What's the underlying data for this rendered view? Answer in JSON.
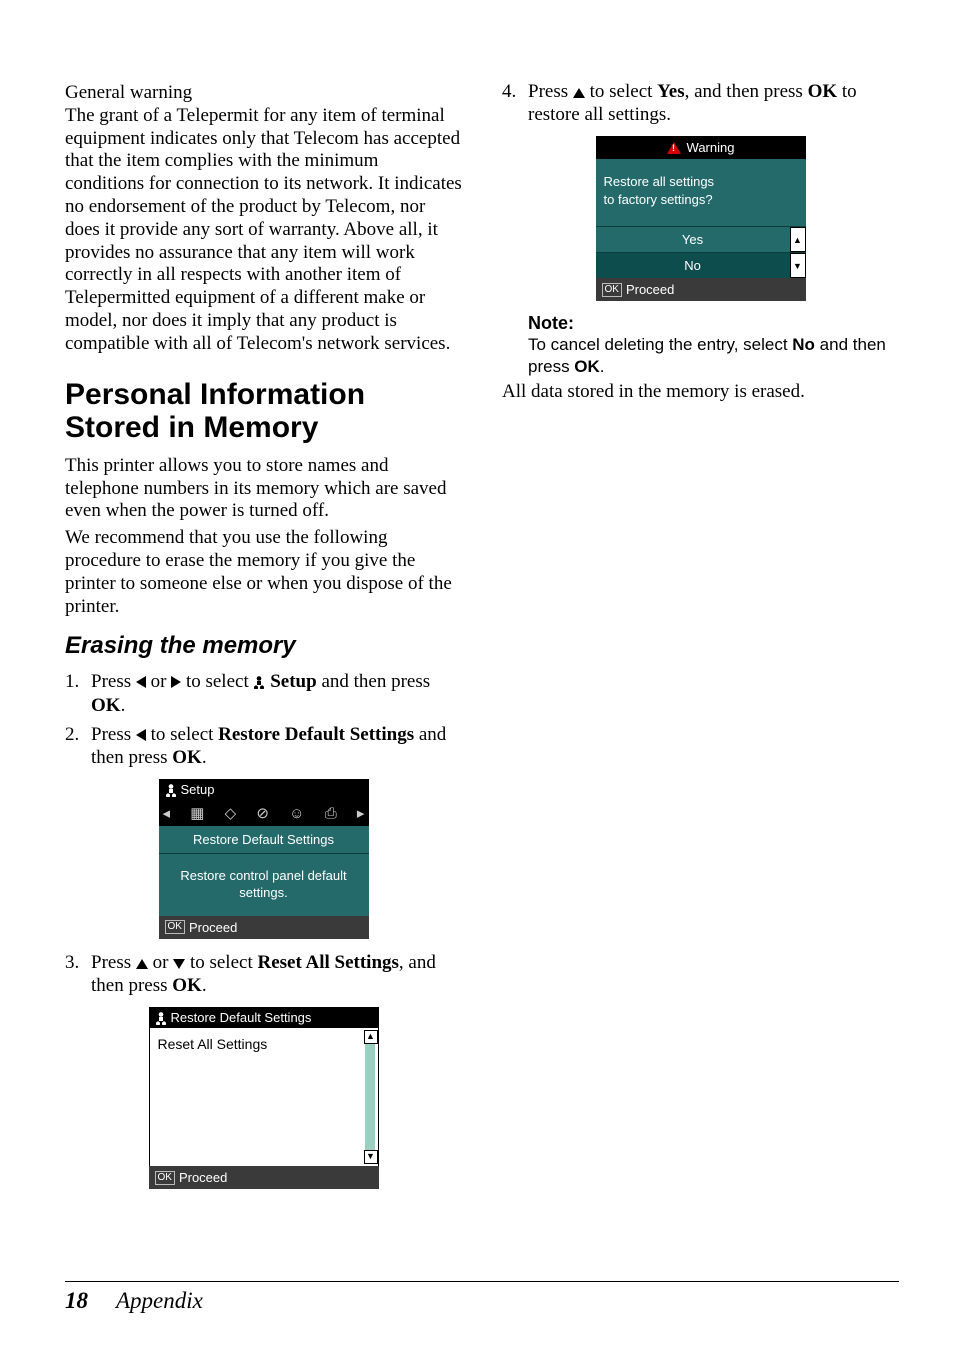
{
  "col1": {
    "gw_title": "General warning",
    "gw_body": "The grant of a Telepermit for any item of terminal equipment indicates only that Telecom has accepted that the item complies with the minimum conditions for connection to its network. It indicates no endorsement of the product by Telecom, nor does it provide any sort of warranty. Above all, it provides no assurance that any item will work correctly in all respects with another item of Telepermitted equipment of a different make or model, nor does it imply that any product is compatible with all of Telecom's network services.",
    "h1": "Personal Information Stored in Memory",
    "p1": "This printer allows you to store names and telephone numbers in its memory which are saved even when the power is turned off.",
    "p2": "We recommend that you use the following procedure to erase the memory if you give the printer to someone else or when you dispose of the printer.",
    "h2": "Erasing the memory",
    "s1a": "Press ",
    "s1b": " or ",
    "s1c": " to select ",
    "s1d": " Setup",
    "s1e": " and then press ",
    "s1f": "OK",
    "s1g": ".",
    "s2a": "Press ",
    "s2b": " to select ",
    "s2c": "Restore Default Settings",
    "s2d": " and then press ",
    "s2e": "OK",
    "s2f": ".",
    "lcd1": {
      "title": "Setup",
      "row1": "Restore Default Settings",
      "row2": "Restore control panel default settings.",
      "proceed": "Proceed",
      "ok": "OK"
    },
    "s3a": "Press ",
    "s3b": " or ",
    "s3c": " to select ",
    "s3d": "Reset All Settings",
    "s3e": ", and then press ",
    "s3f": "OK",
    "s3g": ".",
    "lcd2": {
      "title": "Restore Default Settings",
      "item": "Reset All Settings",
      "proceed": "Proceed",
      "ok": "OK"
    }
  },
  "col2": {
    "s4a": "Press ",
    "s4b": " to select ",
    "s4c": "Yes",
    "s4d": ", and then press ",
    "s4e": "OK",
    "s4f": " to restore all settings.",
    "lcd3": {
      "title": "Warning",
      "msg1": "Restore all settings",
      "msg2": "to factory settings?",
      "yes": "Yes",
      "no": "No",
      "proceed": "Proceed",
      "ok": "OK"
    },
    "note_title": "Note:",
    "note_a": "To cancel deleting the entry, select ",
    "note_b": "No",
    "note_c": " and then press ",
    "note_d": "OK",
    "note_e": ".",
    "after": "All data stored in the memory is erased."
  },
  "footer": {
    "page": "18",
    "title": "Appendix"
  }
}
